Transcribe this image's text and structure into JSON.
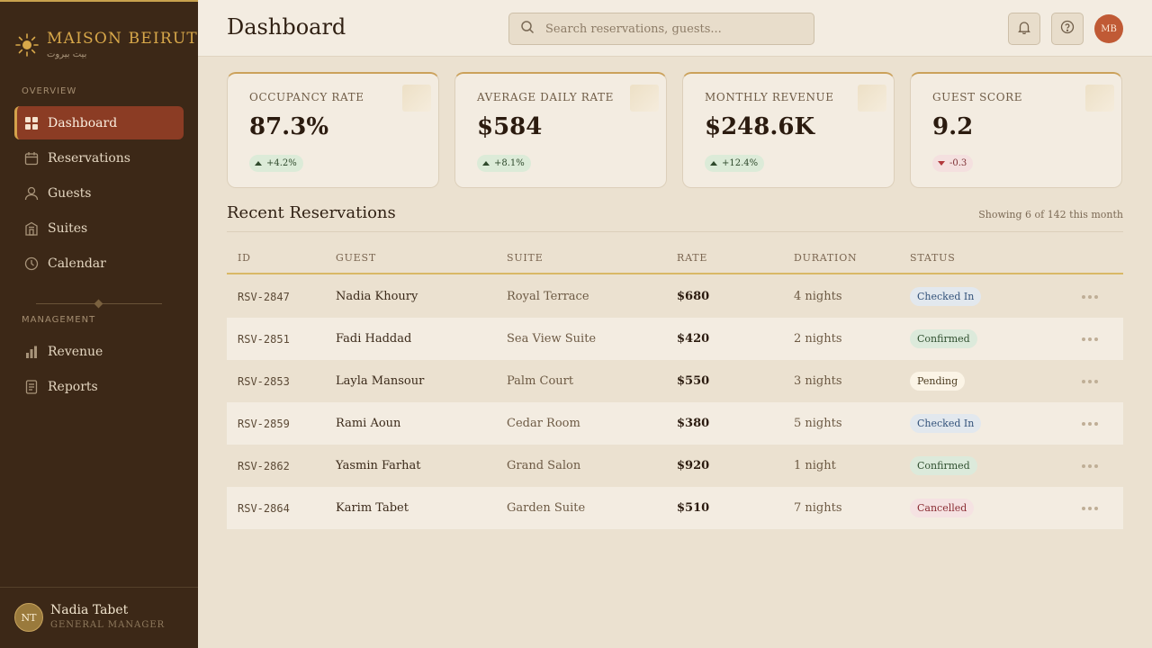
{
  "brand": {
    "name": "MAISON BEIRUT",
    "subtitle": "بيت بيروت"
  },
  "sidebar": {
    "overview_label": "OVERVIEW",
    "management_label": "MANAGEMENT",
    "overview_items": [
      {
        "label": "Dashboard",
        "icon": "grid-icon",
        "active": true
      },
      {
        "label": "Reservations",
        "icon": "calendar-icon"
      },
      {
        "label": "Guests",
        "icon": "user-icon"
      },
      {
        "label": "Suites",
        "icon": "building-icon"
      },
      {
        "label": "Calendar",
        "icon": "clock-icon"
      }
    ],
    "management_items": [
      {
        "label": "Revenue",
        "icon": "bar-chart-icon"
      },
      {
        "label": "Reports",
        "icon": "document-icon"
      }
    ],
    "user": {
      "initials": "NT",
      "name": "Nadia Tabet",
      "role": "GENERAL MANAGER"
    }
  },
  "header": {
    "title": "Dashboard",
    "search_placeholder": "Search reservations, guests...",
    "user_initials": "MB"
  },
  "kpis": [
    {
      "label": "OCCUPANCY RATE",
      "value": "87.3%",
      "change": "+4.2%",
      "trend": "up"
    },
    {
      "label": "AVERAGE DAILY RATE",
      "value": "$584",
      "change": "+8.1%",
      "trend": "up"
    },
    {
      "label": "MONTHLY REVENUE",
      "value": "$248.6K",
      "change": "+12.4%",
      "trend": "up"
    },
    {
      "label": "GUEST SCORE",
      "value": "9.2",
      "change": "-0.3",
      "trend": "down"
    }
  ],
  "reservations": {
    "title": "Recent Reservations",
    "meta": "Showing 6 of 142 this month",
    "columns": [
      "ID",
      "GUEST",
      "SUITE",
      "RATE",
      "DURATION",
      "STATUS"
    ],
    "rows": [
      {
        "id": "RSV-2847",
        "guest": "Nadia Khoury",
        "suite": "Royal Terrace",
        "rate": "$680",
        "duration": "4 nights",
        "status": "Checked In"
      },
      {
        "id": "RSV-2851",
        "guest": "Fadi Haddad",
        "suite": "Sea View Suite",
        "rate": "$420",
        "duration": "2 nights",
        "status": "Confirmed"
      },
      {
        "id": "RSV-2853",
        "guest": "Layla Mansour",
        "suite": "Palm Court",
        "rate": "$550",
        "duration": "3 nights",
        "status": "Pending"
      },
      {
        "id": "RSV-2859",
        "guest": "Rami Aoun",
        "suite": "Cedar Room",
        "rate": "$380",
        "duration": "5 nights",
        "status": "Checked In"
      },
      {
        "id": "RSV-2862",
        "guest": "Yasmin Farhat",
        "suite": "Grand Salon",
        "rate": "$920",
        "duration": "1 night",
        "status": "Confirmed"
      },
      {
        "id": "RSV-2864",
        "guest": "Karim Tabet",
        "suite": "Garden Suite",
        "rate": "$510",
        "duration": "7 nights",
        "status": "Cancelled"
      }
    ]
  },
  "colors": {
    "sidebar": "#3c2817",
    "accent": "#c9a24e",
    "active_nav": "#8b3c24",
    "avatar": "#c05a35"
  }
}
